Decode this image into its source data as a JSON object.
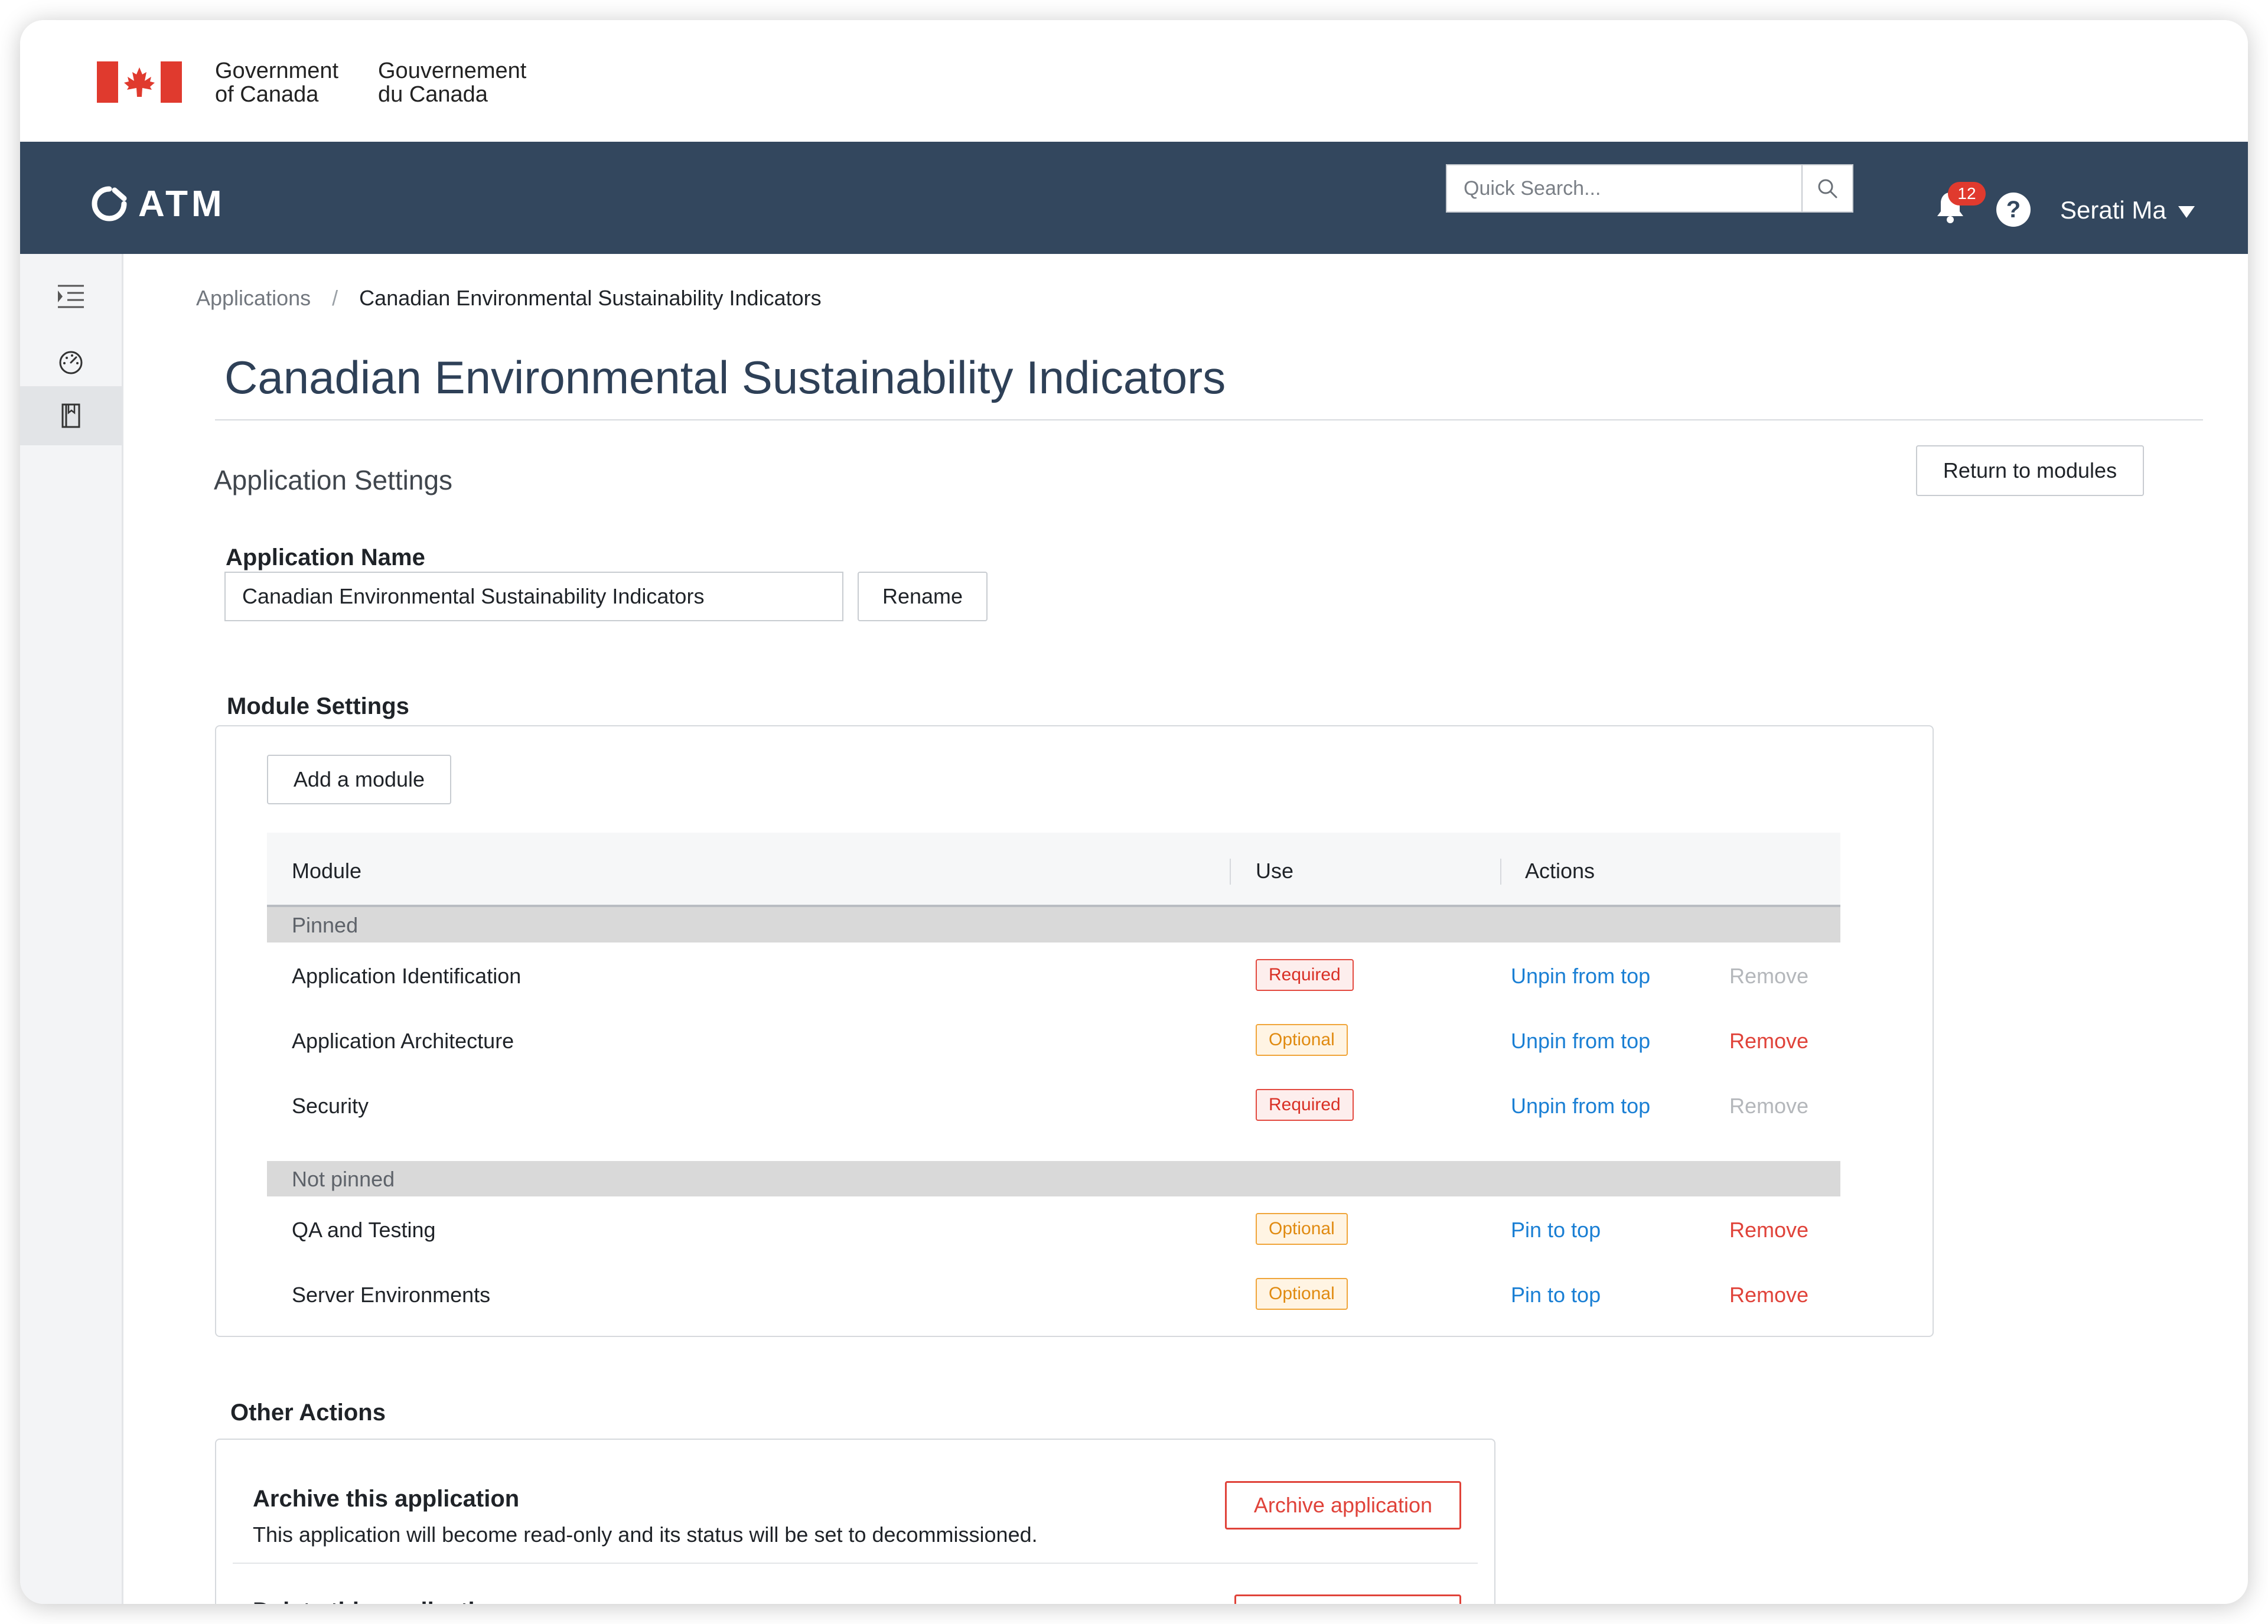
{
  "gov": {
    "en_line1": "Government",
    "en_line2": "of Canada",
    "fr_line1": "Gouvernement",
    "fr_line2": "du Canada",
    "flag_color": "#e03a2e"
  },
  "appbar": {
    "logo": "ATM",
    "search_placeholder": "Quick Search...",
    "notification_count": "12",
    "help": "?",
    "user": "Serati Ma",
    "bg_color": "#33475e"
  },
  "breadcrumb": {
    "root": "Applications",
    "separator": "/",
    "current": "Canadian Environmental Sustainability Indicators"
  },
  "page": {
    "title": "Canadian Environmental Sustainability Indicators",
    "section": "Application Settings",
    "return_button": "Return to modules"
  },
  "app_name": {
    "label": "Application Name",
    "value": "Canadian Environmental Sustainability Indicators",
    "rename_button": "Rename"
  },
  "modules": {
    "heading": "Module Settings",
    "add_button": "Add a module",
    "columns": {
      "module": "Module",
      "use": "Use",
      "actions": "Actions"
    },
    "groups": [
      {
        "label": "Pinned",
        "rows": [
          {
            "name": "Application Identification",
            "use": "Required",
            "pin_action": "Unpin from top",
            "remove": "Remove",
            "removable": false
          },
          {
            "name": "Application Architecture",
            "use": "Optional",
            "pin_action": "Unpin from top",
            "remove": "Remove",
            "removable": true
          },
          {
            "name": "Security",
            "use": "Required",
            "pin_action": "Unpin from top",
            "remove": "Remove",
            "removable": false
          }
        ]
      },
      {
        "label": "Not pinned",
        "rows": [
          {
            "name": "QA and Testing",
            "use": "Optional",
            "pin_action": "Pin to top",
            "remove": "Remove",
            "removable": true
          },
          {
            "name": "Server Environments",
            "use": "Optional",
            "pin_action": "Pin to top",
            "remove": "Remove",
            "removable": true
          }
        ]
      }
    ]
  },
  "other_actions": {
    "heading": "Other Actions",
    "archive_title": "Archive this application",
    "archive_desc": "This application will become read-only and its status will be set to decommissioned.",
    "archive_button": "Archive application",
    "delete_title": "Delete this application"
  },
  "icons": {
    "sidebar": [
      "menu-collapse-icon",
      "dashboard-gauge-icon",
      "book-icon"
    ],
    "search": "search-icon",
    "bell": "bell-icon",
    "caret": "caret-down-icon"
  }
}
